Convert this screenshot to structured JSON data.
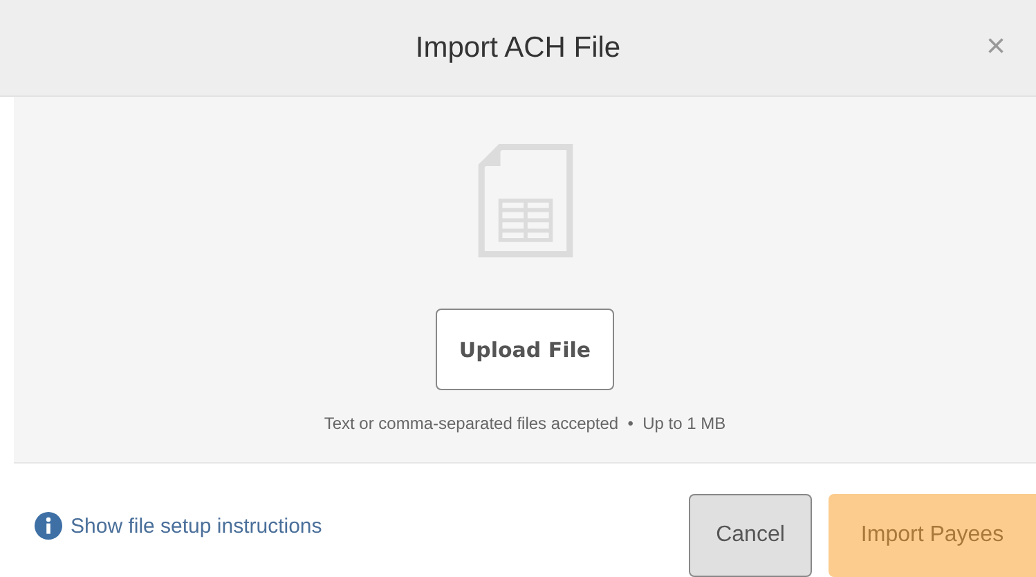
{
  "dialog": {
    "title": "Import ACH File",
    "close": "×"
  },
  "upload": {
    "button": "Upload File",
    "hint": "Text or comma-separated files accepted  •  Up to 1 MB"
  },
  "footer": {
    "link": "Show file setup instructions",
    "buttons": [
      {
        "label": "Cancel",
        "kind": "secondary",
        "disabled": false
      },
      {
        "label": "Import Payees",
        "kind": "primary",
        "disabled": true
      }
    ]
  }
}
